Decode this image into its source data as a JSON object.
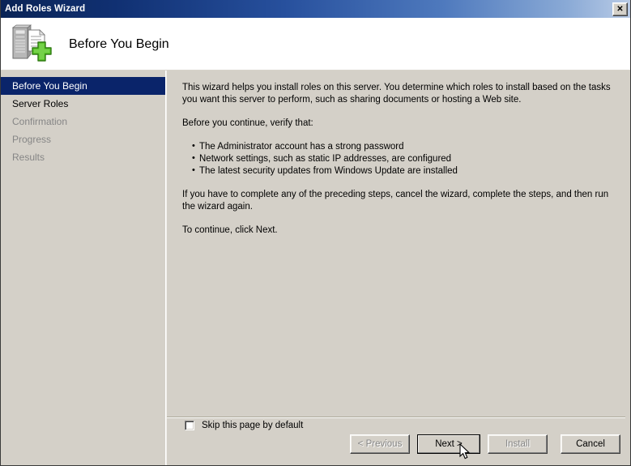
{
  "window": {
    "title": "Add Roles Wizard",
    "close_button_label": "✕",
    "close_icon_name": "close-icon"
  },
  "header": {
    "title": "Before You Begin",
    "icon_name": "server-add-role-icon"
  },
  "sidebar": {
    "items": [
      {
        "label": "Before You Begin",
        "state": "selected"
      },
      {
        "label": "Server Roles",
        "state": "enabled"
      },
      {
        "label": "Confirmation",
        "state": "disabled"
      },
      {
        "label": "Progress",
        "state": "disabled"
      },
      {
        "label": "Results",
        "state": "disabled"
      }
    ]
  },
  "content": {
    "intro": "This wizard helps you install roles on this server. You determine which roles to install based on the tasks you want this server to perform, such as sharing documents or hosting a Web site.",
    "verify_heading": "Before you continue, verify that:",
    "bullets": [
      "The Administrator account has a strong password",
      "Network settings, such as static IP addresses, are configured",
      "The latest security updates from Windows Update are installed"
    ],
    "cancel_note": "If you have to complete any of the preceding steps, cancel the wizard, complete the steps, and then run the wizard again.",
    "continue_note": "To continue, click Next."
  },
  "checkbox": {
    "label": "Skip this page by default",
    "checked": false
  },
  "footer": {
    "buttons": [
      {
        "label": "< Previous",
        "state": "disabled"
      },
      {
        "label": "Next >",
        "state": "default"
      },
      {
        "label": "Install",
        "state": "disabled"
      },
      {
        "label": "Cancel",
        "state": "enabled"
      }
    ]
  },
  "colors": {
    "titlebar_dark": "#0a2456",
    "titlebar_light": "#b9cbe6",
    "selection": "#0a246a",
    "face": "#d4d0c8",
    "disabled_text": "#868686",
    "accent_green": "#4bbd20"
  }
}
